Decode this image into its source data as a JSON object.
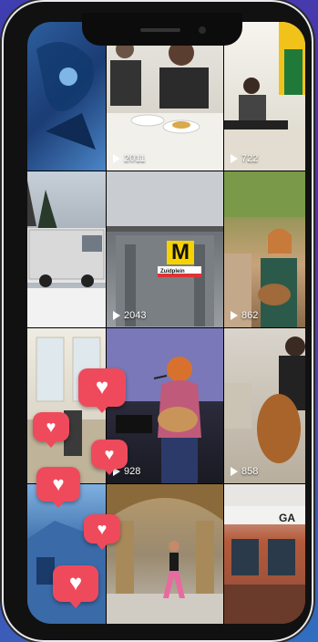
{
  "grid": {
    "tiles": [
      {
        "scene": "blue mural"
      },
      {
        "scene": "people at cafe table",
        "views": "2011"
      },
      {
        "scene": "musician at keyboard",
        "views": "722"
      },
      {
        "scene": "white van in snow"
      },
      {
        "scene": "metro station",
        "views": "2043",
        "metro_letter": "M",
        "sign_text": "Zuidplein"
      },
      {
        "scene": "guitarist outdoors",
        "views": "862"
      },
      {
        "scene": "room with windows"
      },
      {
        "scene": "singer with guitar",
        "views": "928"
      },
      {
        "scene": "cellist",
        "views": "858"
      },
      {
        "scene": "blue mural building"
      },
      {
        "scene": "dancer in hall"
      },
      {
        "scene": "building facade",
        "sign_text": "GA"
      }
    ]
  },
  "colors": {
    "heart": "#ef4a5c",
    "accent_yellow": "#f6d200"
  }
}
